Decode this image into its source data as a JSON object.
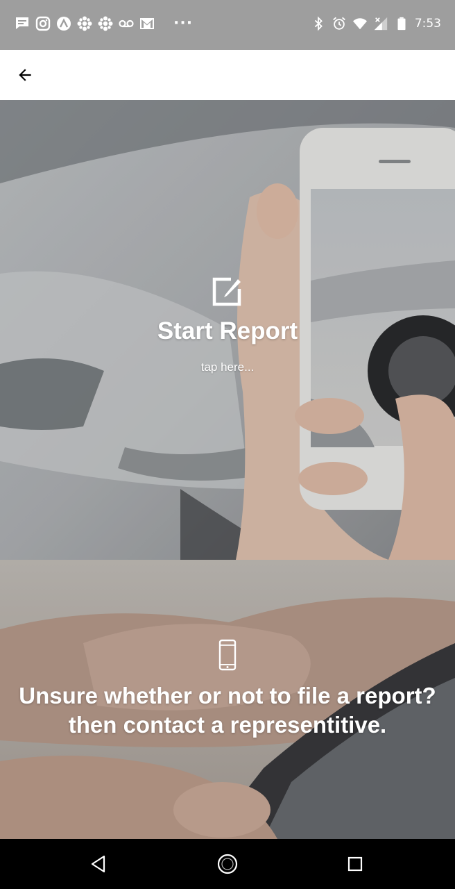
{
  "status_bar": {
    "time": "7:53",
    "left_icons": [
      "message-icon",
      "instagram-icon",
      "delta-icon",
      "cbc-icon",
      "cbc-icon",
      "voicemail-icon",
      "gmail-icon"
    ],
    "more": "···",
    "right_icons": [
      "bluetooth-icon",
      "alarm-icon",
      "wifi-icon",
      "signal-icon",
      "battery-icon"
    ],
    "background": "#9e9e9e"
  },
  "toolbar": {
    "back_icon": "arrow-back-icon"
  },
  "report_panel": {
    "icon": "edit-icon",
    "title": "Start Report",
    "subtitle": "tap here..."
  },
  "contact_panel": {
    "icon": "smartphone-icon",
    "text": "Unsure whether or not to file a report? then contact a representitive."
  },
  "nav_bar": {
    "buttons": [
      "back-triangle-icon",
      "home-circle-icon",
      "recents-square-icon"
    ]
  }
}
